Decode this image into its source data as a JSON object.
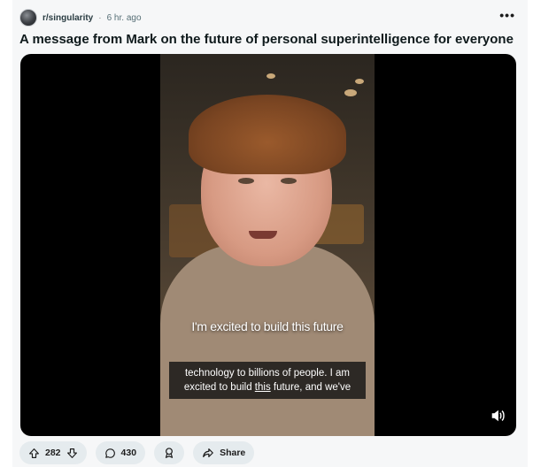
{
  "post": {
    "subreddit": "r/singularity",
    "separator": "·",
    "time": "6 hr. ago",
    "more_label": "•••",
    "title": "A message from Mark on the future of personal superintelligence for everyone"
  },
  "video": {
    "overlay_caption": "I'm excited to build this future",
    "subtitle_line1": "technology to billions of people. I am",
    "subtitle_line2_pre": "excited to build ",
    "subtitle_line2_link": "this",
    "subtitle_line2_post": " future, and we've",
    "sound_icon": "speaker-icon"
  },
  "actions": {
    "upvote_icon": "upvote-icon",
    "vote_count": "282",
    "downvote_icon": "downvote-icon",
    "comment_icon": "comment-icon",
    "comment_count": "430",
    "award_icon": "award-icon",
    "share_icon": "share-icon",
    "share_label": "Share"
  },
  "colors": {
    "card_bg": "#f6f7f8",
    "pill_bg": "#e5ebee",
    "video_bg": "#000000"
  }
}
